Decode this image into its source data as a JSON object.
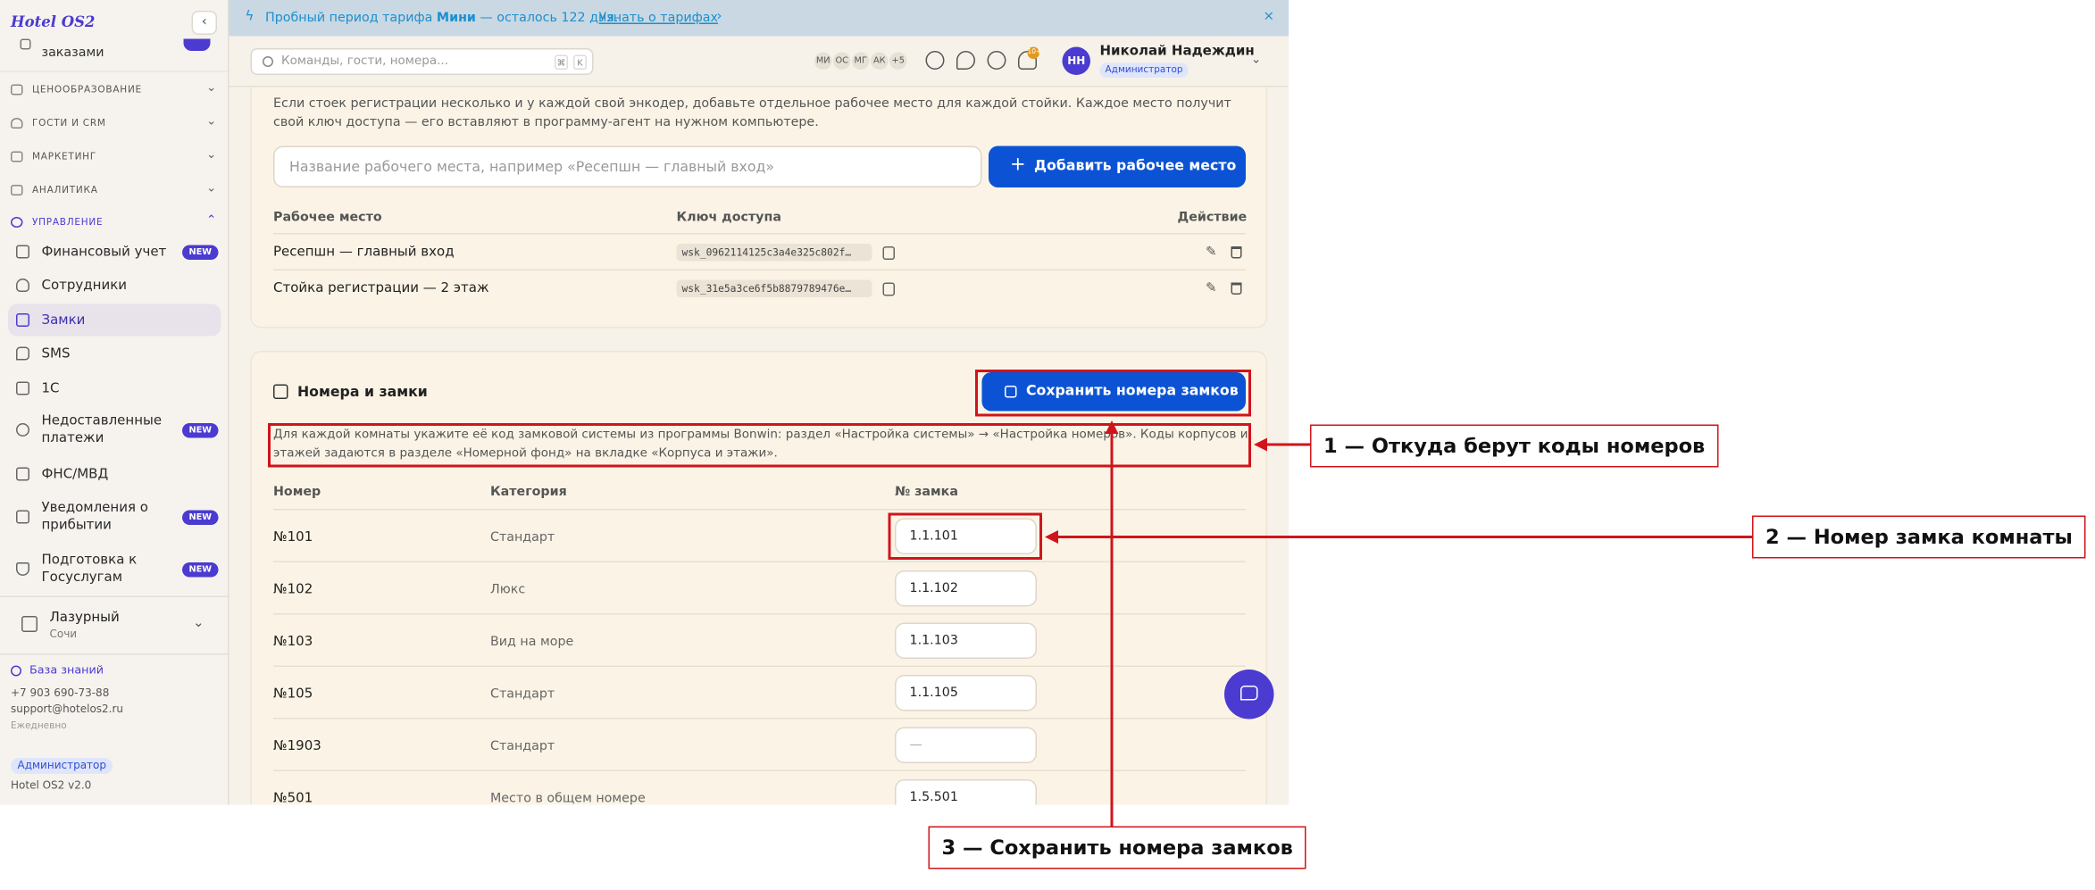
{
  "app": {
    "logo": "Hotel OS2",
    "collapse_icon": "‹"
  },
  "sidebar": {
    "partial_item": "заказами",
    "sections": [
      {
        "label": "ЦЕНООБРАЗОВАНИЕ"
      },
      {
        "label": "ГОСТИ И CRM"
      },
      {
        "label": "МАРКЕТИНГ"
      },
      {
        "label": "АНАЛИТИКА"
      },
      {
        "label": "УПРАВЛЕНИЕ"
      }
    ],
    "items": [
      {
        "label": "Финансовый учет",
        "badge": "NEW"
      },
      {
        "label": "Сотрудники"
      },
      {
        "label": "Замки"
      },
      {
        "label": "SMS"
      },
      {
        "label": "1С"
      },
      {
        "label": "Недоставленные платежи",
        "badge": "NEW"
      },
      {
        "label": "ФНС/МВД"
      },
      {
        "label": "Уведомления о прибытии",
        "badge": "NEW"
      },
      {
        "label": "Подготовка к Госуслугам",
        "badge": "NEW"
      }
    ],
    "hotel": {
      "name": "Лазурный",
      "city": "Сочи"
    },
    "support": {
      "kb": "База знаний",
      "phone": "+7 903 690-73-88",
      "email": "support@hotelos2.ru",
      "hours": "Ежедневно"
    },
    "role": "Администратор",
    "version": "Hotel OS2 v2.0"
  },
  "banner": {
    "text_prefix": "Пробный период тарифа ",
    "plan": "Мини",
    "text_suffix": " — осталось 122 дня.",
    "link": "Узнать о тарифах",
    "arrow": "›",
    "close": "×",
    "color": "#1d8fd0"
  },
  "topbar": {
    "search_placeholder": "Команды, гости, номера...",
    "kbd1": "⌘",
    "kbd2": "K",
    "avatars": [
      "МИ",
      "ОС",
      "МГ",
      "АК",
      "+5"
    ],
    "notif_count": "10+",
    "user_initials": "НН",
    "user_name": "Николай Надеждин",
    "user_role": "Администратор"
  },
  "workstations": {
    "description": "Если стоек регистрации несколько и у каждой свой энкодер, добавьте отдельное рабочее место для каждой стойки. Каждое место получит свой ключ доступа — его вставляют в программу-агент на нужном компьютере.",
    "input_placeholder": "Название рабочего места, например «Ресепшн — главный вход»",
    "add_button": "Добавить рабочее место",
    "add_icon": "+",
    "columns": [
      "Рабочее место",
      "Ключ доступа",
      "Действие"
    ],
    "rows": [
      {
        "name": "Ресепшн — главный вход",
        "key": "wsk_0962114125c3a4e325c802f…"
      },
      {
        "name": "Стойка регистрации — 2 этаж",
        "key": "wsk_31e5a3ce6f5b8879789476e…"
      }
    ]
  },
  "locks": {
    "title": "Номера и замки",
    "save_button": "Сохранить номера замков",
    "description": "Для каждой комнаты укажите её код замковой системы из программы Bonwin: раздел «Настройка системы» → «Настройка номеров». Коды корпусов и этажей задаются в разделе «Номерной фонд» на вкладке «Корпуса и этажи».",
    "columns": [
      "Номер",
      "Категория",
      "№ замка"
    ],
    "rows": [
      {
        "room": "№101",
        "category": "Стандарт",
        "lock": "1.1.101"
      },
      {
        "room": "№102",
        "category": "Люкс",
        "lock": "1.1.102"
      },
      {
        "room": "№103",
        "category": "Вид на море",
        "lock": "1.1.103"
      },
      {
        "room": "№105",
        "category": "Стандарт",
        "lock": "1.1.105"
      },
      {
        "room": "№1903",
        "category": "Стандарт",
        "lock": "—"
      },
      {
        "room": "№501",
        "category": "Место в общем номере",
        "lock": "1.5.501"
      }
    ]
  },
  "annotations": {
    "callout1": "1 — Откуда берут коды номеров",
    "callout2": "2 — Номер замка комнаты",
    "callout3": "3 — Сохранить номера замков",
    "color": "#d0141b"
  }
}
